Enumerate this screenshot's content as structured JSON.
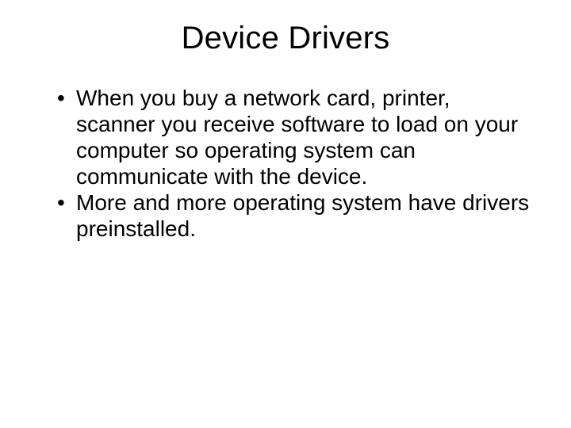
{
  "slide": {
    "title": "Device Drivers",
    "bullets": [
      "When you buy a network card, printer, scanner you receive software to load on your computer so operating system can communicate with the device.",
      "More and more operating system have drivers preinstalled."
    ]
  }
}
